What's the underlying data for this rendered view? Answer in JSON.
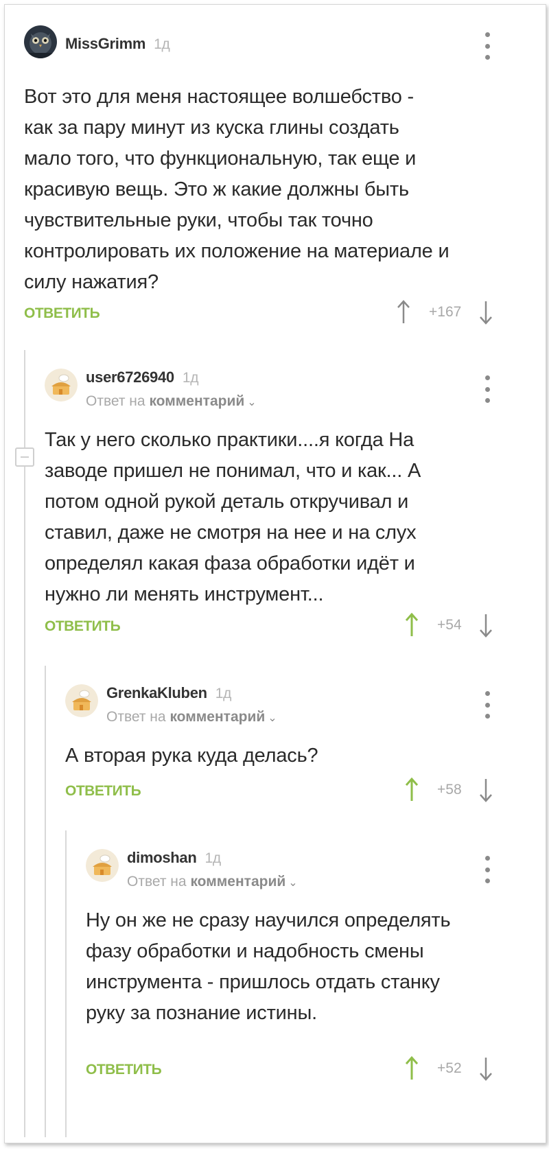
{
  "colors": {
    "accent_green": "#8fbe4a",
    "muted_text": "#a8a8a8",
    "upvoted_green": "#8fbe4a",
    "arrow_gray": "#8a8a8a"
  },
  "comments": [
    {
      "author": "MissGrimm",
      "time": "1д",
      "reply_to": null,
      "text": "Вот это для меня настоящее волшебство -\nкак за пару минут из куска глины создать\nмало того, что функциональную, так еще и\nкрасивую вещь. Это ж какие должны быть\nчувствительные руки, чтобы так точно\nконтролировать их положение на материале и\nсилу нажатия?",
      "reply_label": "ОТВЕТИТЬ",
      "score": "+167",
      "upvoted": false,
      "avatar_icon": "owl-avatar-icon"
    },
    {
      "author": "user6726940",
      "time": "1д",
      "reply_to": {
        "prefix": "Ответ на",
        "target": "комментарий"
      },
      "text": "Так у него сколько практики....я когда На\nзаводе пришел не понимал, что и как... А\nпотом одной рукой деталь откручивал и\nставил, даже не смотря на нее и на слух\nопределял какая фаза обработки идёт и\nнужно ли менять инструмент...",
      "reply_label": "ОТВЕТИТЬ",
      "score": "+54",
      "upvoted": true,
      "avatar_icon": "default-avatar-icon"
    },
    {
      "author": "GrenkaKluben",
      "time": "1д",
      "reply_to": {
        "prefix": "Ответ на",
        "target": "комментарий"
      },
      "text": "А вторая рука куда делась?",
      "reply_label": "ОТВЕТИТЬ",
      "score": "+58",
      "upvoted": true,
      "avatar_icon": "default-avatar-icon"
    },
    {
      "author": "dimoshan",
      "time": "1д",
      "reply_to": {
        "prefix": "Ответ на",
        "target": "комментарий"
      },
      "text": "Ну он же не сразу научился определять\nфазу обработки и надобность смены\nинструмента - пришлось отдать станку\nруку за познание истины.",
      "reply_label": "ОТВЕТИТЬ",
      "score": "+52",
      "upvoted": true,
      "avatar_icon": "default-avatar-icon"
    }
  ]
}
